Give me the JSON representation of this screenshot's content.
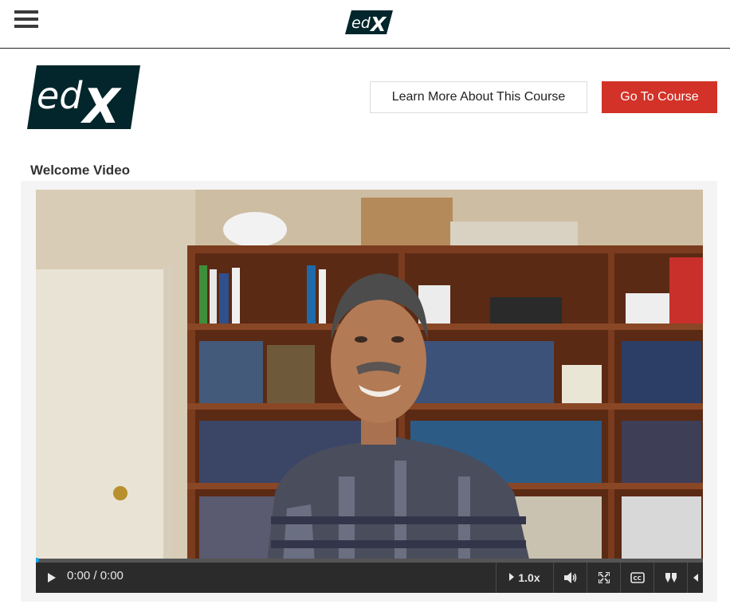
{
  "header": {
    "menu_icon": "hamburger-menu-icon",
    "logo_text": "edX"
  },
  "actions": {
    "learn_more_label": "Learn More About This Course",
    "go_to_course_label": "Go To Course"
  },
  "colors": {
    "brand_red": "#d23228",
    "progress_accent": "#0ea6ec",
    "controls_bg": "#2b2b2b"
  },
  "video": {
    "section_title": "Welcome Video",
    "time_display": "0:00 / 0:00",
    "speed_label": "1.0x",
    "progress": 0,
    "icons": [
      "play-icon",
      "speed-arrow-icon",
      "volume-icon",
      "fullscreen-icon",
      "closed-captions-icon",
      "transcript-quote-icon",
      "caret-left-icon"
    ]
  }
}
